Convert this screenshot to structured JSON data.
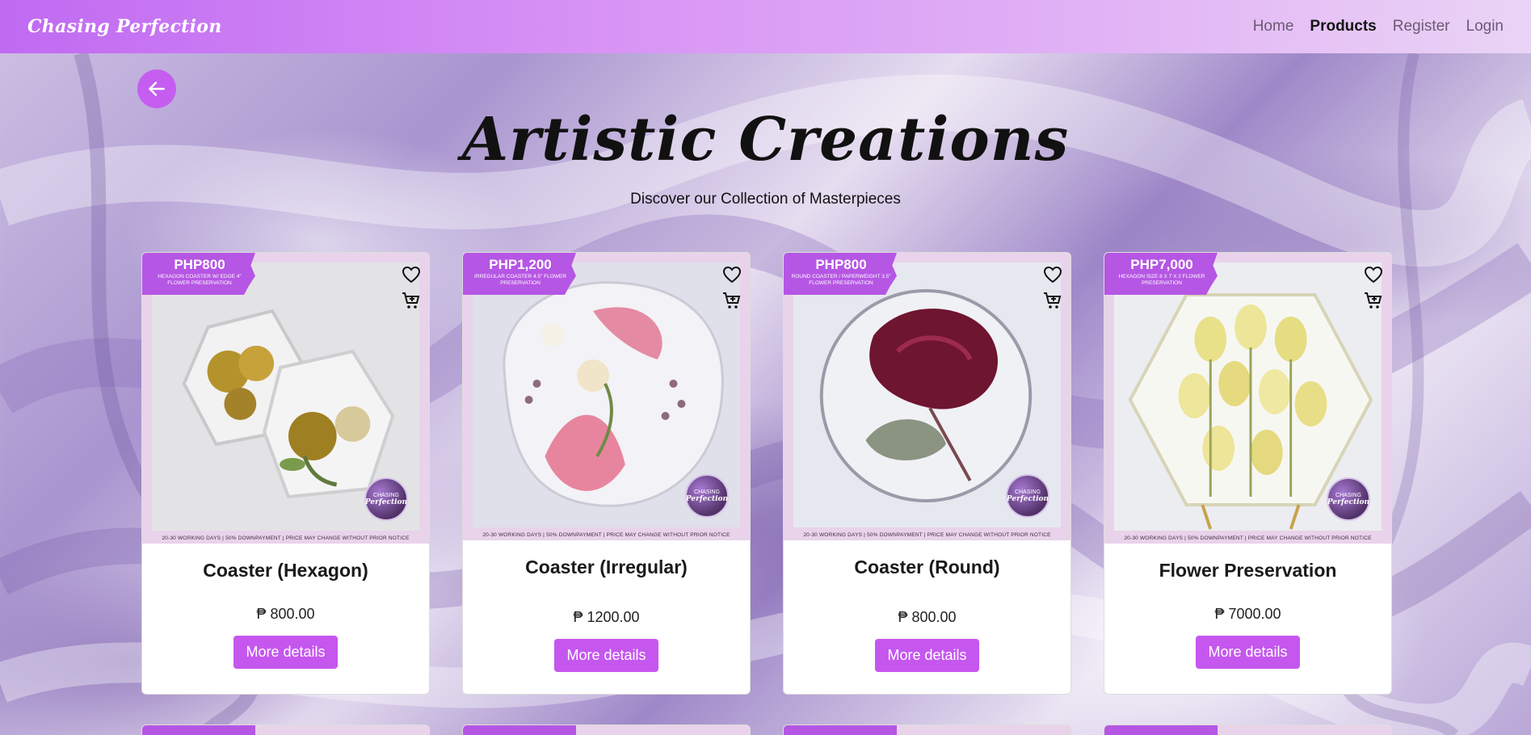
{
  "nav": {
    "brand": "Chasing Perfection",
    "links": [
      {
        "label": "Home",
        "active": false
      },
      {
        "label": "Products",
        "active": true
      },
      {
        "label": "Register",
        "active": false
      },
      {
        "label": "Login",
        "active": false
      }
    ]
  },
  "back_button": {
    "icon": "arrow-left-icon"
  },
  "hero": {
    "title": "Artistic Creations",
    "subtitle": "Discover our Collection of Masterpieces"
  },
  "products": [
    {
      "banner_price": "PHP800",
      "banner_desc": "Hexagon Coaster w/ Edge 4\" Flower Preservation",
      "fine_print": "20-30 WORKING DAYS | 50% DOWNPAYMENT | PRICE MAY CHANGE WITHOUT PRIOR NOTICE",
      "seal_top": "CHASING",
      "seal_bottom": "Perfection",
      "title": "Coaster (Hexagon)",
      "price": "₱ 800.00",
      "button": "More details"
    },
    {
      "banner_price": "PHP1,200",
      "banner_desc": "Irregular Coaster 4.5\" Flower Preservation",
      "fine_print": "20-30 WORKING DAYS | 50% DOWNPAYMENT | PRICE MAY CHANGE WITHOUT PRIOR NOTICE",
      "seal_top": "CHASING",
      "seal_bottom": "Perfection",
      "title": "Coaster (Irregular)",
      "price": "₱ 1200.00",
      "button": "More details"
    },
    {
      "banner_price": "PHP800",
      "banner_desc": "Round Coaster / Paperweight 3.5\" Flower Preservation",
      "fine_print": "20-30 WORKING DAYS | 50% DOWNPAYMENT | PRICE MAY CHANGE WITHOUT PRIOR NOTICE",
      "seal_top": "CHASING",
      "seal_bottom": "Perfection",
      "title": "Coaster (Round)",
      "price": "₱ 800.00",
      "button": "More details"
    },
    {
      "banner_price": "PHP7,000",
      "banner_desc": "Hexagon Size 8 x 7 x 2 Flower Preservation",
      "fine_print": "20-30 WORKING DAYS | 50% DOWNPAYMENT | PRICE MAY CHANGE WITHOUT PRIOR NOTICE",
      "seal_top": "CHASING",
      "seal_bottom": "Perfection",
      "title": "Flower Preservation",
      "price": "₱ 7000.00",
      "button": "More details"
    }
  ],
  "icons": {
    "wishlist": "heart-icon",
    "cart": "cart-plus-icon"
  },
  "colors": {
    "accent": "#c557ef",
    "banner": "#b656e4",
    "card_frame": "#e9d3ea"
  }
}
